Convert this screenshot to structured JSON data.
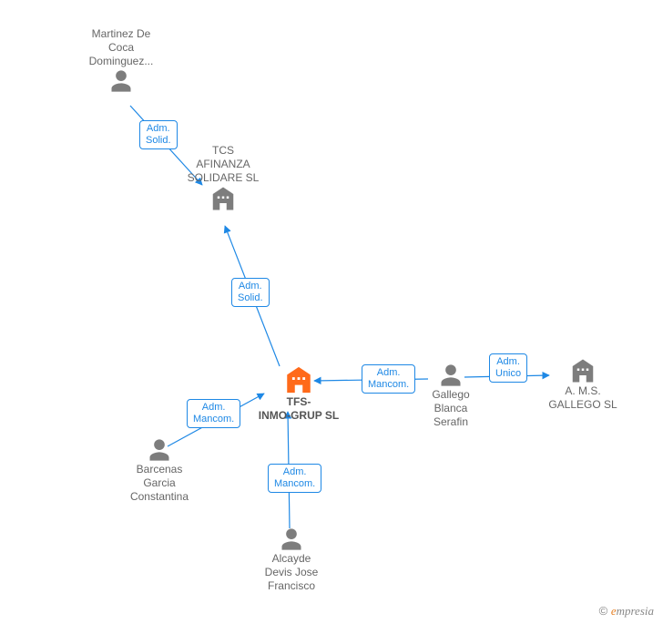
{
  "nodes": {
    "martinez": {
      "label": "Martinez De\nCoca\nDominguez..."
    },
    "tcs": {
      "label": "TCS\nAFINANZA\nSOLIDARE SL"
    },
    "center": {
      "label": "TFS-\nINMO-GRUP SL"
    },
    "barcenas": {
      "label": "Barcenas\nGarcia\nConstantina"
    },
    "alcayde": {
      "label": "Alcayde\nDevis Jose\nFrancisco"
    },
    "gallego": {
      "label": "Gallego\nBlanca\nSerafin"
    },
    "ams": {
      "label": "A. M.S.\nGALLEGO  SL"
    }
  },
  "edges": {
    "e1": {
      "label": "Adm.\nSolid."
    },
    "e2": {
      "label": "Adm.\nSolid."
    },
    "e3": {
      "label": "Adm.\nMancom."
    },
    "e4": {
      "label": "Adm.\nMancom."
    },
    "e5": {
      "label": "Adm.\nMancom."
    },
    "e6": {
      "label": "Adm.\nUnico"
    }
  },
  "footer": {
    "copyright": "©",
    "brand_first": "e",
    "brand_rest": "mpresia"
  },
  "colors": {
    "edge": "#1e88e5",
    "person": "#7d7d7d",
    "company": "#7d7d7d",
    "center": "#ff6a1a"
  }
}
